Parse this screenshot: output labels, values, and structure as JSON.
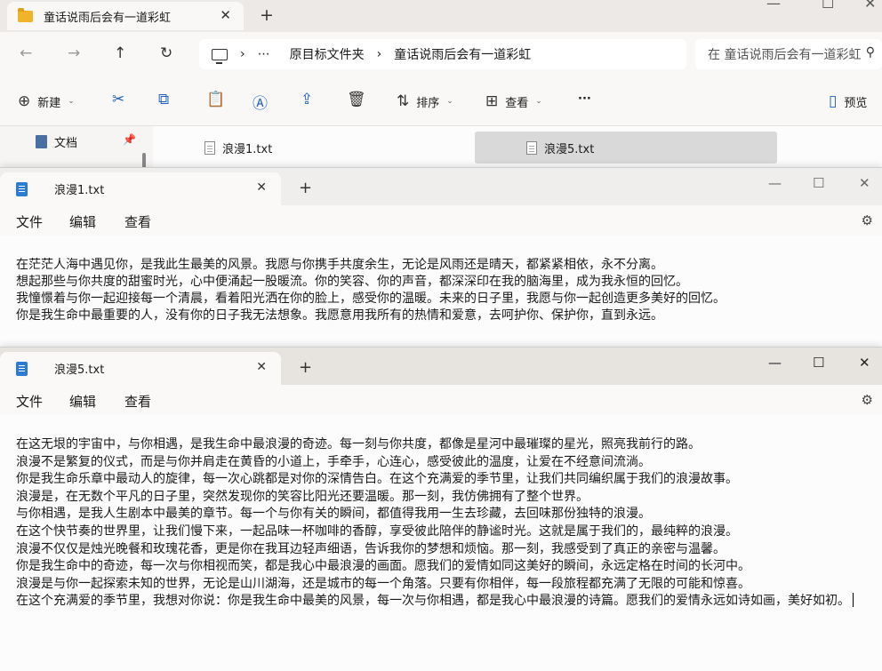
{
  "explorer": {
    "tab_title": "童话说雨后会有一道彩虹",
    "breadcrumb": [
      "⋯",
      "原目标文件夹",
      "童话说雨后会有一道彩虹"
    ],
    "search_placeholder": "在 童话说雨后会有一道彩虹",
    "toolbar": {
      "new_label": "新建",
      "sort_label": "排序",
      "view_label": "查看",
      "more_label": "···",
      "preview_label": "预览"
    },
    "sidebar": {
      "documents_label": "文档"
    },
    "files": [
      "浪漫1.txt",
      "浪漫5.txt"
    ]
  },
  "notepad1": {
    "tab_title": "浪漫1.txt",
    "menu": [
      "文件",
      "编辑",
      "查看"
    ],
    "lines": [
      "在茫茫人海中遇见你，是我此生最美的风景。我愿与你携手共度余生，无论是风雨还是晴天，都紧紧相依，永不分离。",
      "想起那些与你共度的甜蜜时光，心中便涌起一股暖流。你的笑容、你的声音，都深深印在我的脑海里，成为我永恒的回忆。",
      "我憧憬着与你一起迎接每一个清晨，看着阳光洒在你的脸上，感受你的温暖。未来的日子里，我愿与你一起创造更多美好的回忆。",
      "你是我生命中最重要的人，没有你的日子我无法想象。我愿意用我所有的热情和爱意，去呵护你、保护你，直到永远。"
    ]
  },
  "notepad2": {
    "tab_title": "浪漫5.txt",
    "menu": [
      "文件",
      "编辑",
      "查看"
    ],
    "lines": [
      "在这无垠的宇宙中，与你相遇，是我生命中最浪漫的奇迹。每一刻与你共度，都像是星河中最璀璨的星光，照亮我前行的路。",
      "浪漫不是繁复的仪式，而是与你并肩走在黄昏的小道上，手牵手，心连心，感受彼此的温度，让爱在不经意间流淌。",
      "你是我生命乐章中最动人的旋律，每一次心跳都是对你的深情告白。在这个充满爱的季节里，让我们共同编织属于我们的浪漫故事。",
      "浪漫是，在无数个平凡的日子里，突然发现你的笑容比阳光还要温暖。那一刻，我仿佛拥有了整个世界。",
      "与你相遇，是我人生剧本中最美的章节。每一个与你有关的瞬间，都值得我用一生去珍藏，去回味那份独特的浪漫。",
      "在这个快节奏的世界里，让我们慢下来，一起品味一杯咖啡的香醇，享受彼此陪伴的静谧时光。这就是属于我们的，最纯粹的浪漫。",
      "浪漫不仅仅是烛光晚餐和玫瑰花香，更是你在我耳边轻声细语，告诉我你的梦想和烦恼。那一刻，我感受到了真正的亲密与温馨。",
      "你是我生命中的奇迹，每一次与你相视而笑，都是我心中最浪漫的画面。愿我们的爱情如同这美好的瞬间，永远定格在时间的长河中。",
      "浪漫是与你一起探索未知的世界，无论是山川湖海，还是城市的每一个角落。只要有你相伴，每一段旅程都充满了无限的可能和惊喜。",
      "在这个充满爱的季节里，我想对你说：你是我生命中最美的风景，每一次与你相遇，都是我心中最浪漫的诗篇。愿我们的爱情永远如诗如画，美好如初。"
    ]
  }
}
